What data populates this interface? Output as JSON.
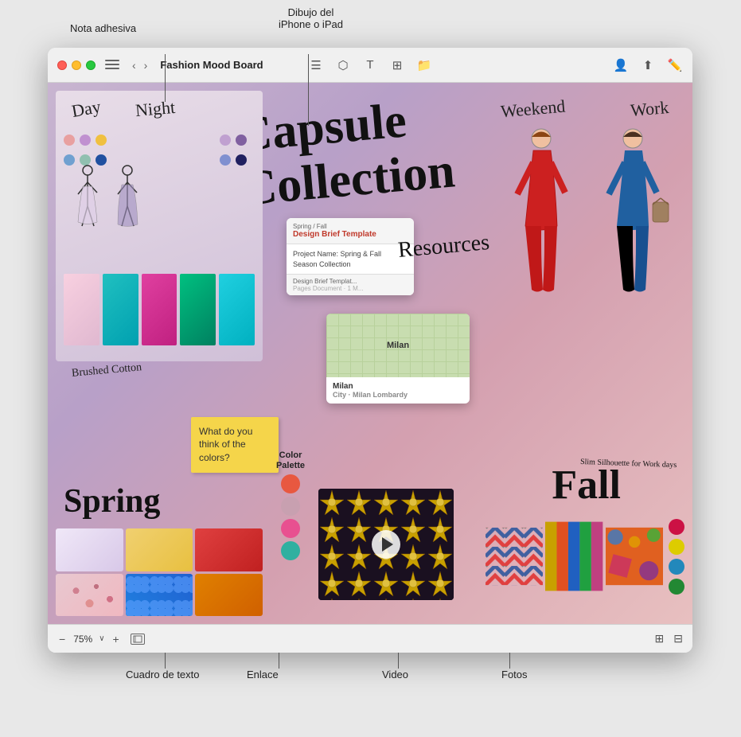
{
  "annotations": {
    "nota_adhesiva": "Nota adhesiva",
    "dibujo_iphone": "Dibujo del\niPhone o iPad",
    "cuadro_texto": "Cuadro de texto",
    "enlace": "Enlace",
    "video": "Video",
    "fotos": "Fotos"
  },
  "titlebar": {
    "title": "Fashion Mood Board",
    "back_arrow": "‹",
    "forward_arrow": "›"
  },
  "toolbar": {
    "icons": [
      "text-icon",
      "shapes-icon",
      "text-box-icon",
      "image-icon",
      "folder-icon"
    ]
  },
  "canvas": {
    "capsule_text": "Capsule\nCollection",
    "day_label": "Day",
    "night_label": "Night",
    "spring_text": "Spring",
    "fall_text": "Fall",
    "resources_text": "Resources",
    "brushed_cotton": "Brushed\nCotton",
    "slim_silhouette": "Slim Silhouette\nfor Work days",
    "weekend_label": "Weekend",
    "work_label": "Work"
  },
  "sticky_note": {
    "text": "What do you think of the colors?"
  },
  "design_brief": {
    "header": "Spring / Fall",
    "title": "Design Brief Template",
    "content": "Project Name: Spring & Fall Season Collection",
    "footer_title": "Design Brief Templat...",
    "footer_sub": "Pages Document · 1 M..."
  },
  "map": {
    "city": "Milan",
    "subtitle": "City · Milan Lombardy"
  },
  "color_palette": {
    "label": "Color\nPalette",
    "colors": [
      "#e85840",
      "#c8a0b0",
      "#e85090",
      "#30b0a0"
    ]
  },
  "right_colors": [
    "#cc1144",
    "#ddcc00",
    "#2288bb",
    "#228833"
  ],
  "zoom": {
    "minus": "−",
    "value": "75%",
    "arrow": "∨",
    "plus": "+"
  }
}
